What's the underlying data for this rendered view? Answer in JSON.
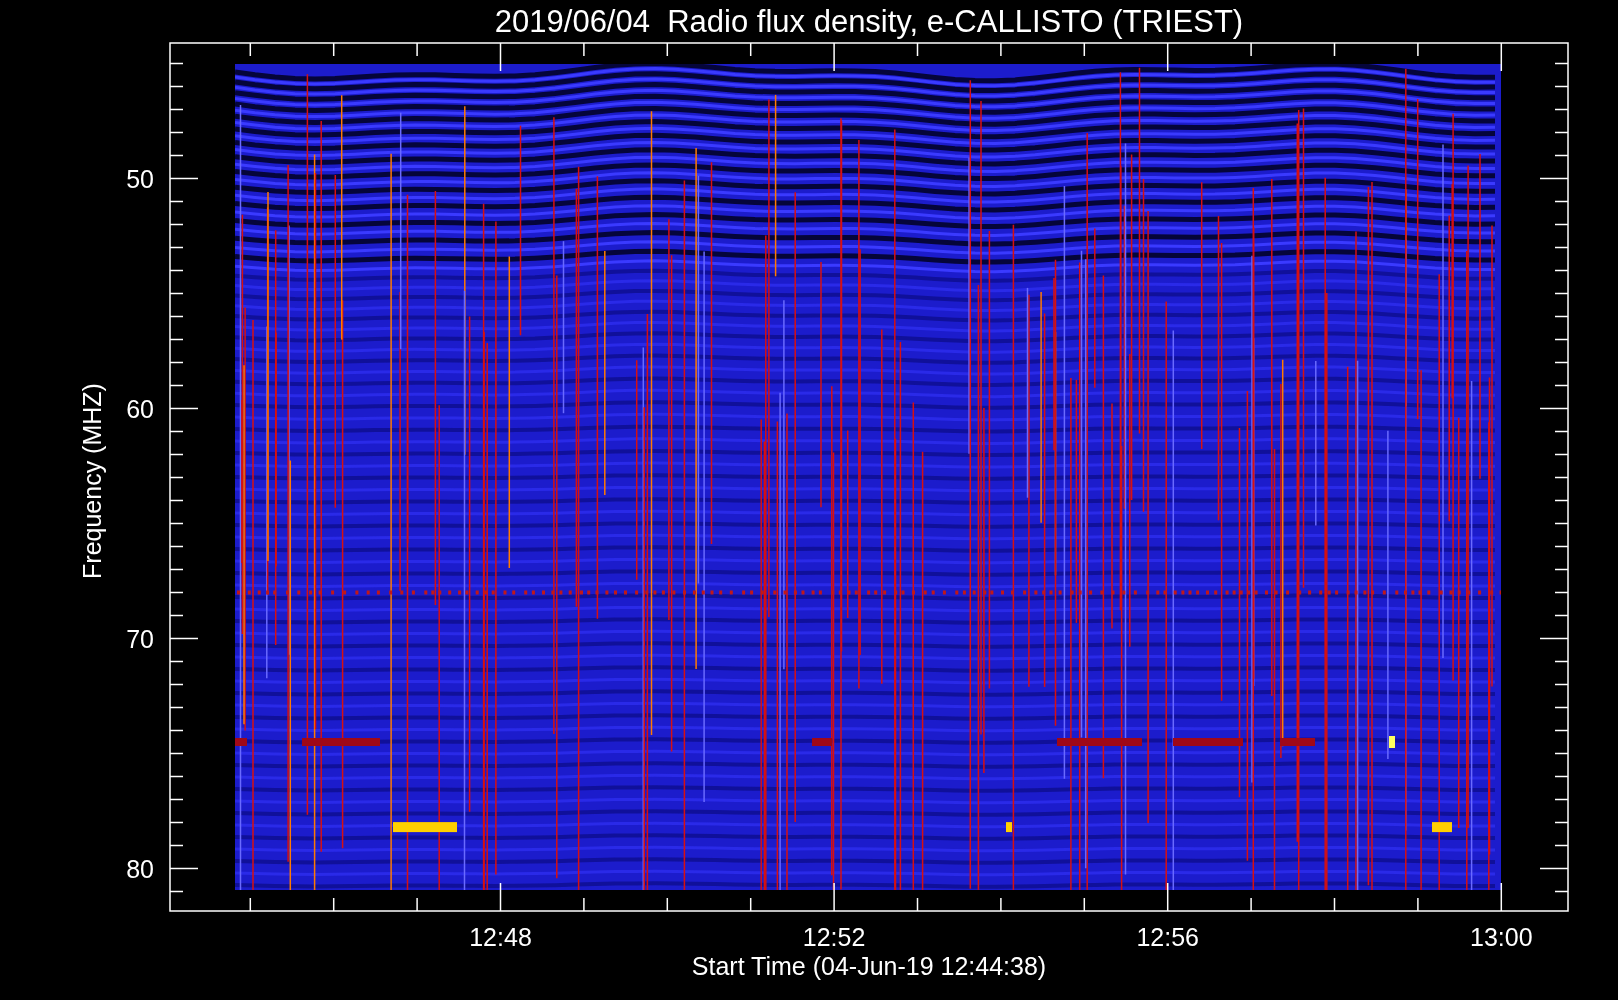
{
  "title": "2019/06/04  Radio flux density, e-CALLISTO (TRIEST)",
  "y_axis": {
    "label": "Frequency (MHZ)",
    "ticks": [
      "50",
      "60",
      "70",
      "80"
    ]
  },
  "x_axis": {
    "label": "Start Time (04-Jun-19 12:44:38)",
    "ticks": [
      "12:48",
      "12:52",
      "12:56",
      "13:00"
    ]
  }
}
